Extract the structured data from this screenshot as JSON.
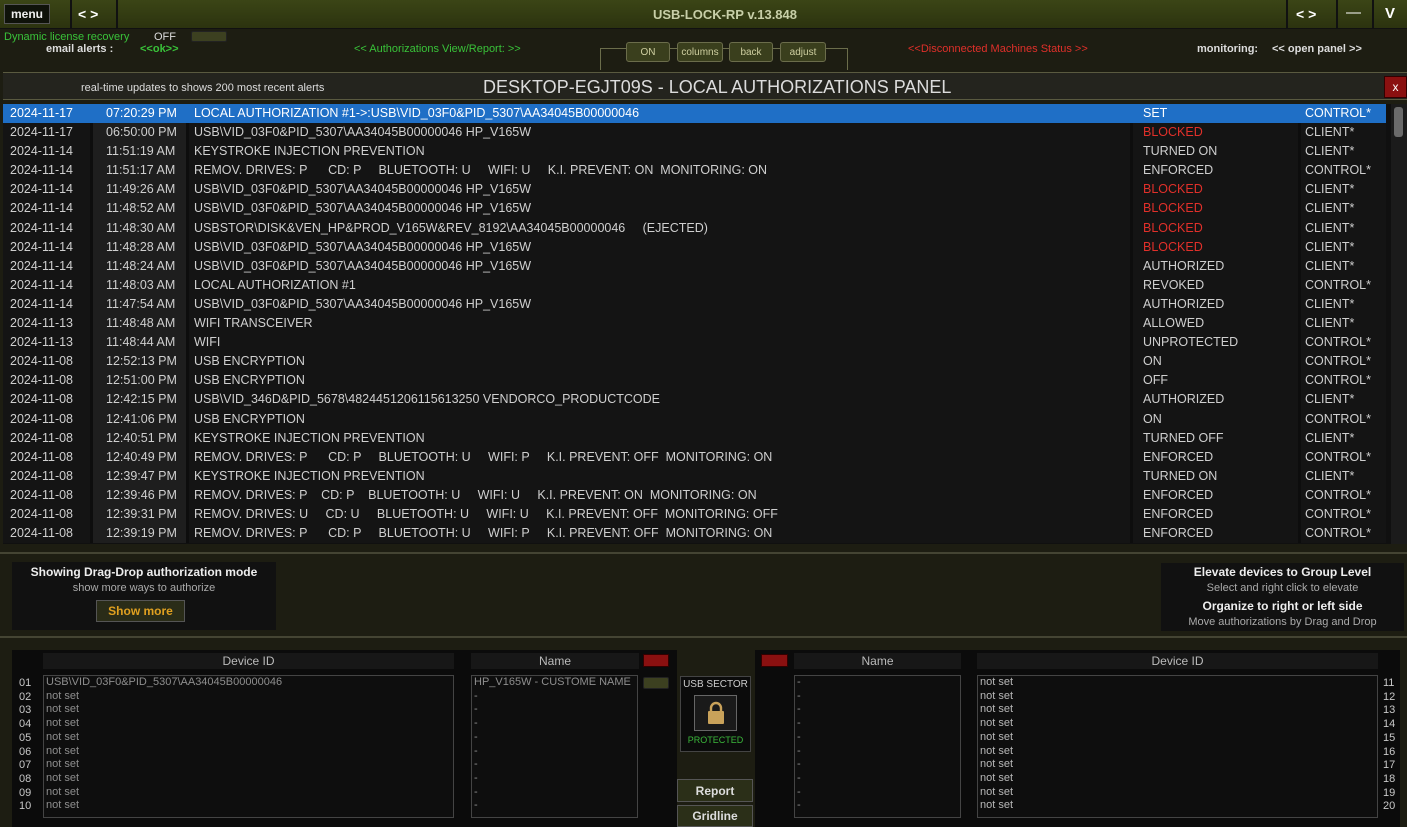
{
  "topbar": {
    "menu": "menu",
    "nav_left": "< >",
    "title": "USB-LOCK-RP v.13.848",
    "nav_right": "< >",
    "minimize": "—",
    "v": "V"
  },
  "sub": {
    "license_label": "Dynamic license recovery",
    "license_value": "OFF",
    "email_label": "email alerts :",
    "email_value": "<<ok>>",
    "auth_link": "<< Authorizations View/Report: >>",
    "tabs": [
      "ON",
      "columns",
      "back",
      "adjust"
    ],
    "disconnected": "<<Disconnected Machines Status >>",
    "monitoring_label": "monitoring:",
    "monitoring_link": "<< open panel >>"
  },
  "panel": {
    "info": "real-time updates to shows 200 most recent alerts",
    "title": "DESKTOP-EGJT09S - LOCAL AUTHORIZATIONS PANEL",
    "close": "x"
  },
  "rows": [
    {
      "date": "2024-11-17",
      "time": "07:20:29 PM",
      "desc": "LOCAL AUTHORIZATION #1->:USB\\VID_03F0&PID_5307\\AA34045B00000046",
      "status": "SET",
      "src": "CONTROL*",
      "sel": true
    },
    {
      "date": "2024-11-17",
      "time": "06:50:00 PM",
      "desc": "USB\\VID_03F0&PID_5307\\AA34045B00000046 HP_V165W",
      "status": "BLOCKED",
      "src": "CLIENT*",
      "red": true
    },
    {
      "date": "2024-11-14",
      "time": "11:51:19 AM",
      "desc": "KEYSTROKE INJECTION PREVENTION",
      "status": "TURNED ON",
      "src": "CLIENT*"
    },
    {
      "date": "2024-11-14",
      "time": "11:51:17 AM",
      "desc": "REMOV. DRIVES: P      CD: P     BLUETOOTH: U     WIFI: U     K.I. PREVENT: ON  MONITORING: ON",
      "status": "ENFORCED",
      "src": "CONTROL*"
    },
    {
      "date": "2024-11-14",
      "time": "11:49:26 AM",
      "desc": "USB\\VID_03F0&PID_5307\\AA34045B00000046 HP_V165W",
      "status": "BLOCKED",
      "src": "CLIENT*",
      "red": true
    },
    {
      "date": "2024-11-14",
      "time": "11:48:52 AM",
      "desc": "USB\\VID_03F0&PID_5307\\AA34045B00000046 HP_V165W",
      "status": "BLOCKED",
      "src": "CLIENT*",
      "red": true
    },
    {
      "date": "2024-11-14",
      "time": "11:48:30 AM",
      "desc": "USBSTOR\\DISK&VEN_HP&PROD_V165W&REV_8192\\AA34045B00000046     (EJECTED)",
      "status": "BLOCKED",
      "src": "CLIENT*",
      "red": true
    },
    {
      "date": "2024-11-14",
      "time": "11:48:28 AM",
      "desc": "USB\\VID_03F0&PID_5307\\AA34045B00000046 HP_V165W",
      "status": "BLOCKED",
      "src": "CLIENT*",
      "red": true
    },
    {
      "date": "2024-11-14",
      "time": "11:48:24 AM",
      "desc": "USB\\VID_03F0&PID_5307\\AA34045B00000046 HP_V165W",
      "status": "AUTHORIZED",
      "src": "CLIENT*"
    },
    {
      "date": "2024-11-14",
      "time": "11:48:03 AM",
      "desc": "LOCAL AUTHORIZATION #1",
      "status": "REVOKED",
      "src": "CONTROL*"
    },
    {
      "date": "2024-11-14",
      "time": "11:47:54 AM",
      "desc": "USB\\VID_03F0&PID_5307\\AA34045B00000046 HP_V165W",
      "status": "AUTHORIZED",
      "src": "CLIENT*"
    },
    {
      "date": "2024-11-13",
      "time": "11:48:48 AM",
      "desc": "WIFI TRANSCEIVER",
      "status": "ALLOWED",
      "src": "CLIENT*"
    },
    {
      "date": "2024-11-13",
      "time": "11:48:44 AM",
      "desc": "WIFI",
      "status": "UNPROTECTED",
      "src": "CONTROL*"
    },
    {
      "date": "2024-11-08",
      "time": "12:52:13 PM",
      "desc": "USB ENCRYPTION",
      "status": "ON",
      "src": "CONTROL*"
    },
    {
      "date": "2024-11-08",
      "time": "12:51:00 PM",
      "desc": "USB ENCRYPTION",
      "status": "OFF",
      "src": "CONTROL*"
    },
    {
      "date": "2024-11-08",
      "time": "12:42:15 PM",
      "desc": "USB\\VID_346D&PID_5678\\4824451206115613250 VENDORCO_PRODUCTCODE",
      "status": "AUTHORIZED",
      "src": "CLIENT*"
    },
    {
      "date": "2024-11-08",
      "time": "12:41:06 PM",
      "desc": "USB ENCRYPTION",
      "status": "ON",
      "src": "CONTROL*"
    },
    {
      "date": "2024-11-08",
      "time": "12:40:51 PM",
      "desc": "KEYSTROKE INJECTION PREVENTION",
      "status": "TURNED OFF",
      "src": "CLIENT*"
    },
    {
      "date": "2024-11-08",
      "time": "12:40:49 PM",
      "desc": "REMOV. DRIVES: P      CD: P     BLUETOOTH: U     WIFI: P     K.I. PREVENT: OFF  MONITORING: ON",
      "status": "ENFORCED",
      "src": "CONTROL*"
    },
    {
      "date": "2024-11-08",
      "time": "12:39:47 PM",
      "desc": "KEYSTROKE INJECTION PREVENTION",
      "status": "TURNED ON",
      "src": "CLIENT*"
    },
    {
      "date": "2024-11-08",
      "time": "12:39:46 PM",
      "desc": "REMOV. DRIVES: P    CD: P    BLUETOOTH: U     WIFI: U     K.I. PREVENT: ON  MONITORING: ON",
      "status": "ENFORCED",
      "src": "CONTROL*"
    },
    {
      "date": "2024-11-08",
      "time": "12:39:31 PM",
      "desc": "REMOV. DRIVES: U     CD: U     BLUETOOTH: U     WIFI: U     K.I. PREVENT: OFF  MONITORING: OFF",
      "status": "ENFORCED",
      "src": "CONTROL*"
    },
    {
      "date": "2024-11-08",
      "time": "12:39:19 PM",
      "desc": "REMOV. DRIVES: P      CD: P     BLUETOOTH: U     WIFI: P     K.I. PREVENT: OFF  MONITORING: ON",
      "status": "ENFORCED",
      "src": "CONTROL*"
    }
  ],
  "dragdrop": {
    "title": "Showing Drag-Drop authorization mode",
    "sub": "show more ways to authorize",
    "button": "Show more"
  },
  "elevate": {
    "title": "Elevate devices to Group Level",
    "sub": "Select and right click to elevate",
    "title2": "Organize to right or left side",
    "sub2": "Move authorizations by Drag and Drop"
  },
  "left": {
    "device_header": "Device ID",
    "name_header": "Name",
    "nums": [
      "01",
      "02",
      "03",
      "04",
      "05",
      "06",
      "07",
      "08",
      "09",
      "10"
    ],
    "devices": [
      "USB\\VID_03F0&PID_5307\\AA34045B00000046",
      "not set",
      "not set",
      "not set",
      "not set",
      "not set",
      "not set",
      "not set",
      "not set",
      "not set"
    ],
    "names": [
      "HP_V165W - CUSTOME NAME",
      "-",
      "-",
      "-",
      "-",
      "-",
      "-",
      "-",
      "-",
      "-"
    ]
  },
  "right": {
    "device_header": "Device ID",
    "name_header": "Name",
    "nums": [
      "11",
      "12",
      "13",
      "14",
      "15",
      "16",
      "17",
      "18",
      "19",
      "20"
    ],
    "devices": [
      "not set",
      "not set",
      "not set",
      "not set",
      "not set",
      "not set",
      "not set",
      "not set",
      "not set",
      "not set"
    ],
    "names": [
      "-",
      "-",
      "-",
      "-",
      "-",
      "-",
      "-",
      "-",
      "-",
      "-"
    ]
  },
  "sector": {
    "label": "USB SECTOR",
    "status": "PROTECTED"
  },
  "buttons": {
    "report": "Report",
    "gridline": "Gridline"
  }
}
